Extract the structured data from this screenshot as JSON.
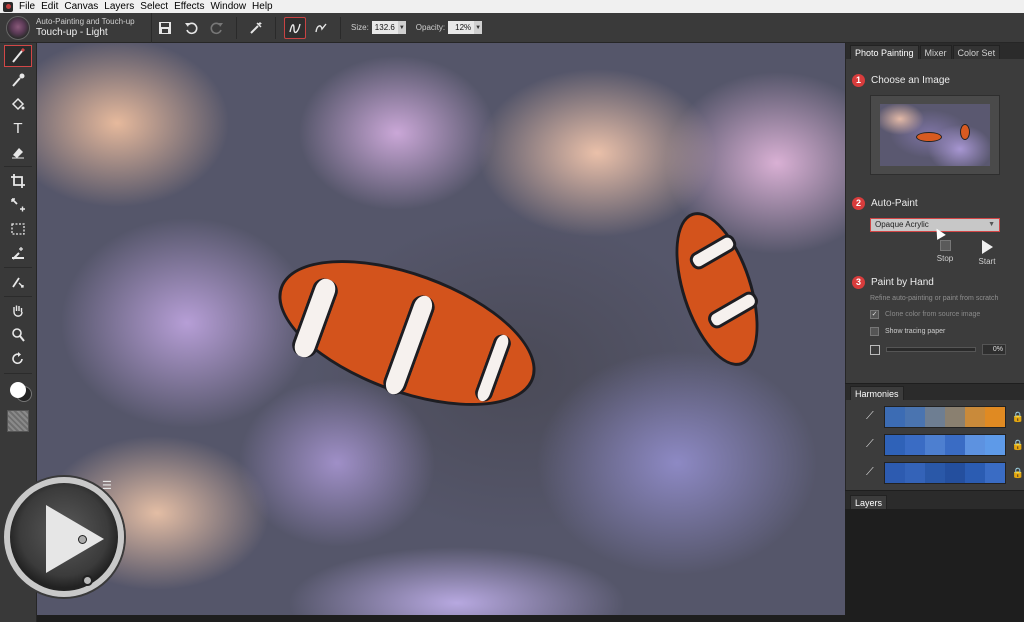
{
  "menu": [
    "File",
    "Edit",
    "Canvas",
    "Layers",
    "Select",
    "Effects",
    "Window",
    "Help"
  ],
  "brush": {
    "category": "Auto-Painting and Touch-up",
    "variant": "Touch-up - Light"
  },
  "property_bar": {
    "size_label": "Size:",
    "size_value": "132.6",
    "opacity_label": "Opacity:",
    "opacity_value": "12%"
  },
  "panel": {
    "tabs": [
      "Photo Painting",
      "Mixer",
      "Color Set"
    ],
    "step1": {
      "num": "1",
      "title": "Choose an Image"
    },
    "step2": {
      "num": "2",
      "title": "Auto-Paint",
      "style_value": "Opaque Acrylic",
      "stop_label": "Stop",
      "start_label": "Start"
    },
    "step3": {
      "num": "3",
      "title": "Paint by Hand",
      "hint": "Refine auto-painting or paint from scratch",
      "clone_label": "Clone color from source image",
      "tracing_label": "Show tracing paper",
      "progress_value": "0%",
      "progress_fraction": 0
    }
  },
  "harmonies": {
    "title": "Harmonies",
    "rows": [
      [
        "#3c6cb4",
        "#4a74b0",
        "#6e7e92",
        "#8a8070",
        "#c98a3a",
        "#e08a22"
      ],
      [
        "#2f62b8",
        "#3a6cc4",
        "#4d7fd0",
        "#3a6cc4",
        "#5d92e0",
        "#5e9ae8"
      ],
      [
        "#2d5bb0",
        "#3463b8",
        "#2a58a8",
        "#244f9e",
        "#2b5cb2",
        "#3a6cc4"
      ]
    ]
  },
  "layers": {
    "title": "Layers"
  },
  "colors": {
    "accent": "#d83c3c",
    "panel_bg": "#3c3c3c",
    "toolbar_bg": "#393939"
  }
}
